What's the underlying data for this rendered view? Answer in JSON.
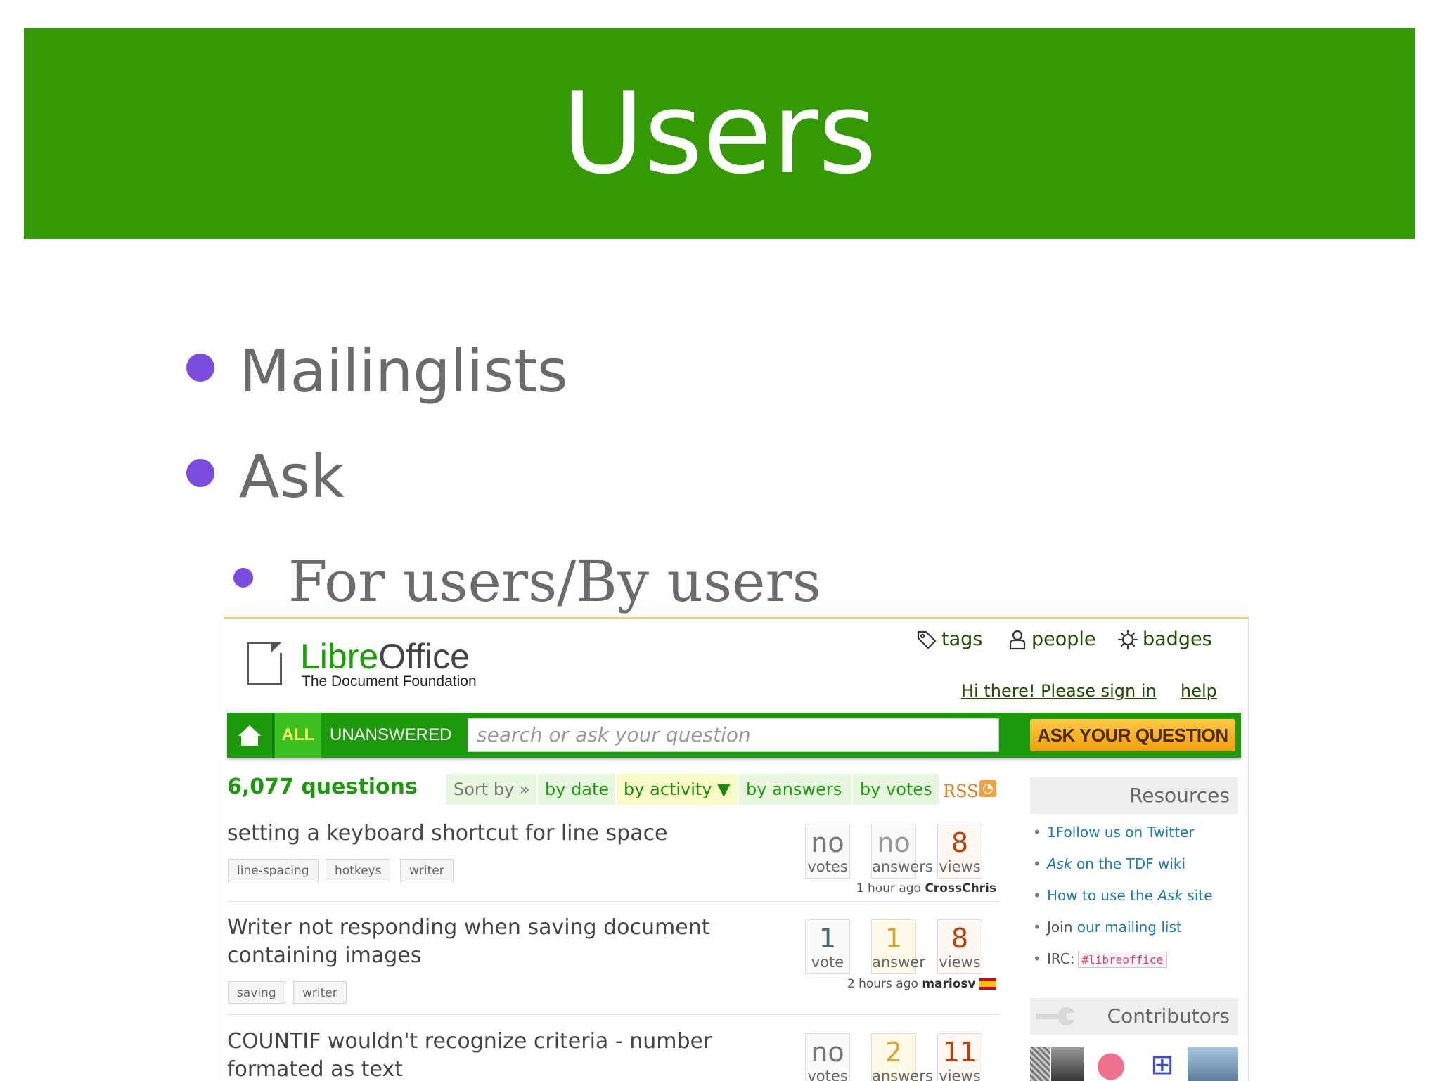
{
  "slide": {
    "title": "Users",
    "bullets": [
      "Mailinglists",
      "Ask"
    ],
    "sub_bullet": "For users/By users",
    "colors": {
      "title_bar": "#339a04",
      "bullet": "#7b4be0"
    }
  },
  "ask": {
    "logo": {
      "libre": "Libre",
      "office": "Office",
      "tagline": "The Document Foundation"
    },
    "nav": {
      "tags": "tags",
      "people": "people",
      "badges": "badges"
    },
    "signin": "Hi there! Please sign in",
    "help": "help",
    "tabs": {
      "all": "ALL",
      "unanswered": "UNANSWERED"
    },
    "search_placeholder": "search or ask your question",
    "ask_button": "ASK YOUR QUESTION",
    "question_count": "6,077 questions",
    "sort": {
      "label": "Sort by »",
      "by_date": "by date",
      "by_activity": "by activity ▼",
      "by_answers": "by answers",
      "by_votes": "by votes"
    },
    "rss": "RSS",
    "questions": [
      {
        "title": "setting a keyboard shortcut for line space",
        "tags": [
          "line-spacing",
          "hotkeys",
          "writer"
        ],
        "votes": "no",
        "votes_label": "votes",
        "answers": "no",
        "answers_label": "answers",
        "views": "8",
        "views_label": "views",
        "time": "1 hour ago",
        "user": "CrossChris"
      },
      {
        "title": "Writer not responding when saving document containing images",
        "tags": [
          "saving",
          "writer"
        ],
        "votes": "1",
        "votes_label": "vote",
        "answers": "1",
        "answers_label": "answer",
        "views": "8",
        "views_label": "views",
        "time": "2 hours ago",
        "user": "mariosv"
      },
      {
        "title": "COUNTIF wouldn't recognize criteria - number formated as text",
        "tags": [],
        "votes": "no",
        "votes_label": "votes",
        "answers": "2",
        "answers_label": "answers",
        "views": "11",
        "views_label": "views"
      }
    ],
    "sidebar": {
      "resources_title": "Resources",
      "resources": {
        "twitter": "1Follow us on Twitter",
        "ask_pre": "Ask",
        "ask_post": " on the TDF wiki",
        "howto_pre": "How to use the ",
        "howto_em": "Ask",
        "howto_post": " site",
        "join": "Join ",
        "mailing": "our mailing list",
        "irc_label": "IRC:",
        "irc_channel": "#libreoffice"
      },
      "contributors_title": "Contributors"
    }
  }
}
